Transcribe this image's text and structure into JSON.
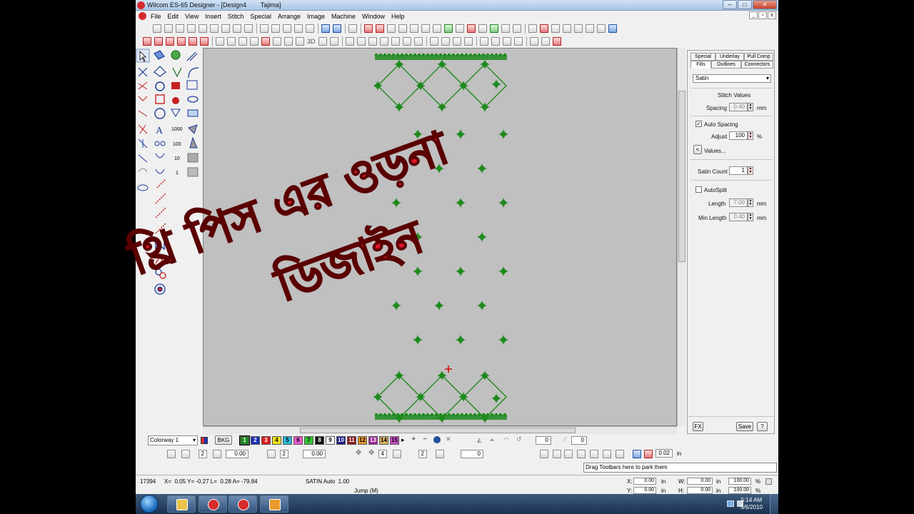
{
  "window": {
    "title": "Wilcom ES-65 Designer - [Design4        Tajima]",
    "controls": [
      "minimize",
      "maximize",
      "close"
    ]
  },
  "menu": [
    "File",
    "Edit",
    "View",
    "Insert",
    "Stitch",
    "Special",
    "Arrange",
    "Image",
    "Machine",
    "Window",
    "Help"
  ],
  "toolbar": {
    "view_3d": "3D",
    "zoom_value": "0"
  },
  "left_tools": {
    "number_labels": [
      "1000",
      "100",
      "10",
      "1"
    ],
    "letter_label": "A"
  },
  "overlay": {
    "line1": "থ্রি পিস এর ওড়না",
    "line2": "ডিজাইন",
    "color": "#e2182e"
  },
  "design": {
    "stitch_color": "#1e8a1e",
    "cursor_color": "#d01010"
  },
  "properties": {
    "tabs_row1": [
      "Special",
      "Underlay",
      "Pull Comp"
    ],
    "tabs_row2": [
      "Fills",
      "Outlines",
      "Connectors"
    ],
    "fill_type": "Satin",
    "stitch_values_heading": "Stitch Values",
    "spacing_label": "Spacing",
    "spacing_value": "0.40",
    "spacing_unit": "mm",
    "auto_spacing_label": "Auto Spacing",
    "auto_spacing_checked": true,
    "adjust_label": "Adjust",
    "adjust_value": "100",
    "adjust_unit": "%",
    "values_button": "Values...",
    "satin_count_label": "Satin Count",
    "satin_count_value": "1",
    "autosplit_label": "AutoSplit",
    "autosplit_checked": false,
    "length_label": "Length",
    "length_value": "7.00",
    "length_unit": "mm",
    "min_length_label": "Min Length",
    "min_length_value": "0.40",
    "min_length_unit": "mm",
    "fx_button": "FX",
    "save_button": "Save",
    "help_button": "?"
  },
  "colorway": {
    "selected": "Colorway 1",
    "bkg_label": "BKG",
    "swatches": [
      {
        "n": "1",
        "color": "#1e8a1e",
        "fg": "#ffffff"
      },
      {
        "n": "2",
        "color": "#1c2fb8",
        "fg": "#ffffff"
      },
      {
        "n": "3",
        "color": "#d81e1e",
        "fg": "#ffffff"
      },
      {
        "n": "4",
        "color": "#f2e01a",
        "fg": "#000000"
      },
      {
        "n": "5",
        "color": "#2ab8d8",
        "fg": "#000000"
      },
      {
        "n": "6",
        "color": "#e85ad0",
        "fg": "#000000"
      },
      {
        "n": "7",
        "color": "#36c036",
        "fg": "#000000"
      },
      {
        "n": "8",
        "color": "#101010",
        "fg": "#ffffff"
      },
      {
        "n": "9",
        "color": "#ffffff",
        "fg": "#000000"
      },
      {
        "n": "10",
        "color": "#1a1a8a",
        "fg": "#ffffff"
      },
      {
        "n": "11",
        "color": "#8a1a1a",
        "fg": "#ffffff"
      },
      {
        "n": "12",
        "color": "#e89a2a",
        "fg": "#000000"
      },
      {
        "n": "13",
        "color": "#a02a9a",
        "fg": "#ffffff"
      },
      {
        "n": "14",
        "color": "#d8b060",
        "fg": "#000000"
      },
      {
        "n": "15",
        "color": "#c850c8",
        "fg": "#000000"
      }
    ]
  },
  "toolbar2": {
    "offset_x": "0.00",
    "offset_y": "0.00",
    "count_a": "2",
    "count_b": "2",
    "count_c": "4",
    "count_d": "2",
    "angle": "0",
    "thickness": "0.02",
    "thickness_unit": "in"
  },
  "tooltip": "Drag Toolbars here to park them",
  "status": {
    "stitch_count": "17394",
    "coords": "X=  0.05 Y= -0.27 L=  0.28 A= -79.84",
    "stitch_type": "SATIN Auto  1.00",
    "mode": "Jump (M)",
    "x_label": "X:",
    "x_value": "0.00",
    "y_label": "Y:",
    "y_value": "0.00",
    "w_label": "W:",
    "w_value": "0.00",
    "h_label": "H:",
    "h_value": "0.00",
    "unit": "in",
    "scale_w": "100.00",
    "scale_h": "100.00",
    "pct": "%"
  },
  "taskbar": {
    "time": "5:14 AM",
    "date": "5/6/2010"
  }
}
